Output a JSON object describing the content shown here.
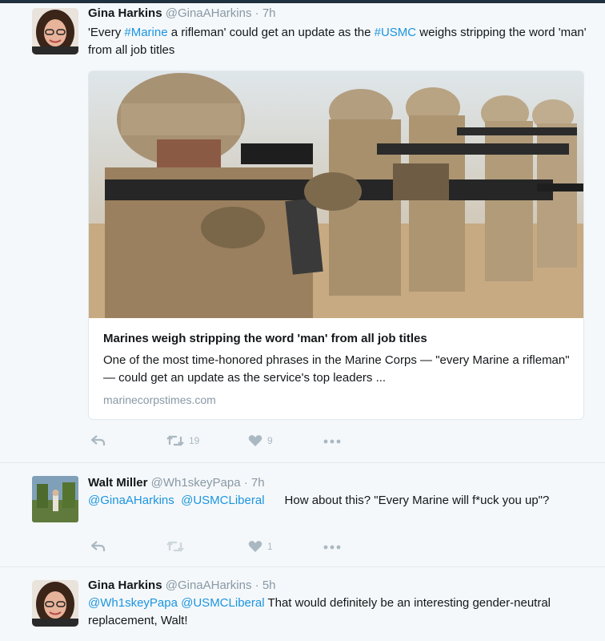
{
  "tweets": [
    {
      "name": "Gina Harkins",
      "handle": "@GinaAHarkins",
      "time": "7h",
      "text_parts": [
        "'Every ",
        "#Marine",
        " a rifleman' could get an update as the ",
        "#USMC",
        " weighs stripping the word 'man' from all job titles"
      ],
      "card": {
        "title": "Marines weigh stripping the word 'man' from all job titles",
        "description": "One of the most time-honored phrases in the Marine Corps — \"every Marine a rifleman\" — could get an update as the service's top leaders ...",
        "domain": "marinecorpstimes.com"
      },
      "retweets": "19",
      "likes": "9"
    },
    {
      "name": "Walt Miller",
      "handle": "@Wh1skeyPapa",
      "time": "7h",
      "mention1": "@GinaAHarkins",
      "mention2": "@USMCLiberal",
      "text": "How about this? \"Every Marine will f*uck you up\"?",
      "retweets": "",
      "likes": "1"
    },
    {
      "name": "Gina Harkins",
      "handle": "@GinaAHarkins",
      "time": "5h",
      "mention1": "@Wh1skeyPapa",
      "mention2": "@USMCLiberal",
      "text": "That would definitely be an interesting gender-neutral replacement, Walt!"
    }
  ],
  "colors": {
    "link": "#1b95e0",
    "muted": "#8899a6",
    "icon": "#aab8c2",
    "background": "#f5f8fa"
  },
  "icons": [
    "reply-icon",
    "retweet-icon",
    "heart-icon",
    "more-icon"
  ]
}
